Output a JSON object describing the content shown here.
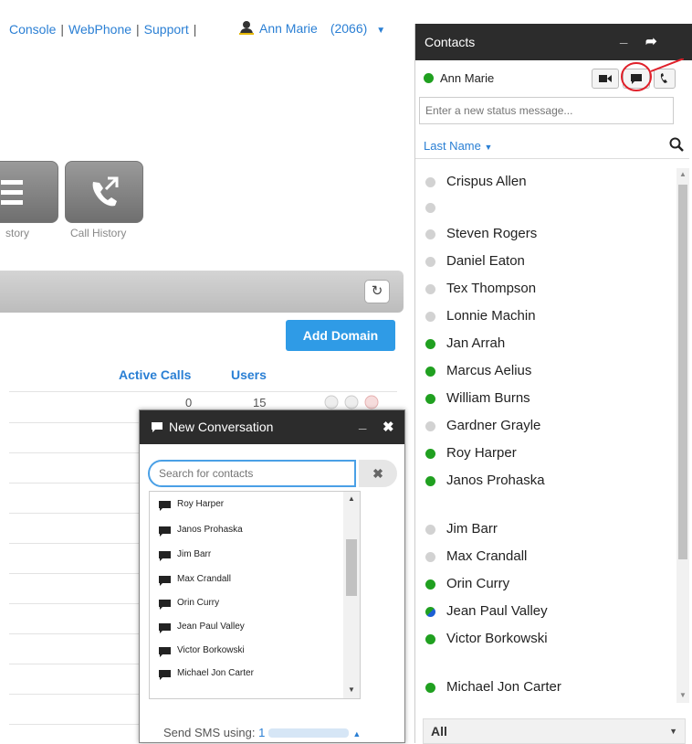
{
  "topnav": {
    "links": [
      "Console",
      "WebPhone",
      "Support"
    ],
    "user_name": "Ann Marie",
    "user_ext": "(2066)"
  },
  "apps": {
    "history_label": "story",
    "call_history_label": "Call History"
  },
  "main": {
    "add_domain_label": "Add Domain",
    "columns": {
      "active_calls": "Active Calls",
      "users": "Users"
    },
    "first_row": {
      "active_calls": "0",
      "users": "15"
    }
  },
  "contacts_panel": {
    "title": "Contacts",
    "me": {
      "name": "Ann Marie"
    },
    "status_placeholder": "Enter a new status message...",
    "sort_label": "Last Name",
    "filter_label": "All",
    "items": [
      {
        "name": "Crispus Allen",
        "status": "gray"
      },
      {
        "name": "",
        "status": "gray"
      },
      {
        "name": "Steven Rogers",
        "status": "gray"
      },
      {
        "name": "Daniel Eaton",
        "status": "gray"
      },
      {
        "name": "Tex Thompson",
        "status": "gray"
      },
      {
        "name": "Lonnie Machin",
        "status": "gray"
      },
      {
        "name": "Jan Arrah",
        "status": "green"
      },
      {
        "name": "Marcus Aelius",
        "status": "green"
      },
      {
        "name": "William Burns",
        "status": "green"
      },
      {
        "name": "Gardner Grayle",
        "status": "gray"
      },
      {
        "name": "Roy Harper",
        "status": "green"
      },
      {
        "name": "Janos Prohaska",
        "status": "green"
      },
      {
        "name": "Jim Barr",
        "status": "gray"
      },
      {
        "name": "Max Crandall",
        "status": "gray"
      },
      {
        "name": "Orin Curry",
        "status": "green"
      },
      {
        "name": "Jean Paul Valley",
        "status": "mixed"
      },
      {
        "name": "Victor Borkowski",
        "status": "green"
      },
      {
        "name": "Michael Jon Carter",
        "status": "green"
      }
    ]
  },
  "new_conversation": {
    "title": "New Conversation",
    "search_placeholder": "Search for contacts",
    "list": [
      "Roy Harper",
      "Janos Prohaska",
      "Jim Barr",
      "Max Crandall",
      "Orin Curry",
      "Jean Paul Valley",
      "Victor Borkowski",
      "Michael Jon Carter"
    ],
    "sms_label": "Send SMS using:",
    "sms_prefix": "1"
  },
  "colors": {
    "accent": "#2a7fd4",
    "button": "#2f9be6",
    "header_dark": "#2c2c2c",
    "online": "#20a020",
    "offline": "#d2d2d2",
    "annotation": "#e0202a"
  }
}
